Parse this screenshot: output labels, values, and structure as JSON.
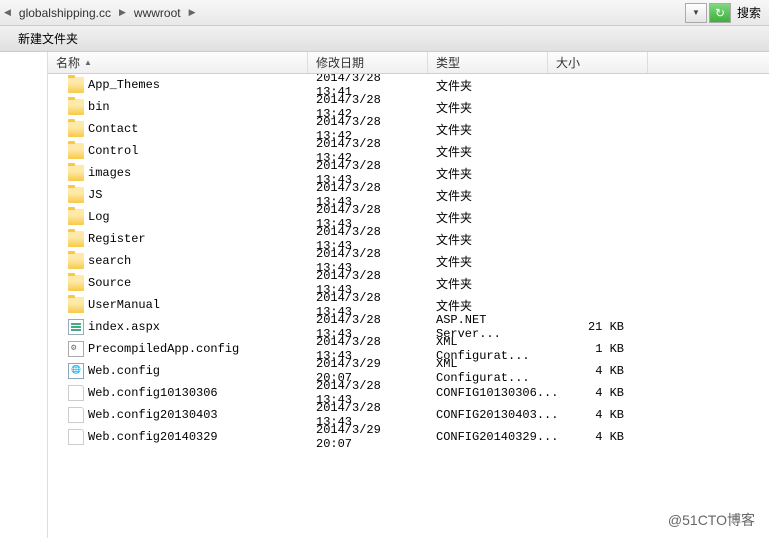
{
  "breadcrumb": {
    "items": [
      "globalshipping.cc",
      "wwwroot"
    ]
  },
  "toolbar": {
    "search_label": "搜索"
  },
  "subtoolbar": {
    "new_folder": "新建文件夹"
  },
  "columns": {
    "name": "名称",
    "date": "修改日期",
    "type": "类型",
    "size": "大小"
  },
  "files": [
    {
      "icon": "folder",
      "name": "App_Themes",
      "date": "2014/3/28 13:41",
      "type": "文件夹",
      "size": ""
    },
    {
      "icon": "folder",
      "name": "bin",
      "date": "2014/3/28 13:42",
      "type": "文件夹",
      "size": ""
    },
    {
      "icon": "folder",
      "name": "Contact",
      "date": "2014/3/28 13:42",
      "type": "文件夹",
      "size": ""
    },
    {
      "icon": "folder",
      "name": "Control",
      "date": "2014/3/28 13:42",
      "type": "文件夹",
      "size": ""
    },
    {
      "icon": "folder",
      "name": "images",
      "date": "2014/3/28 13:43",
      "type": "文件夹",
      "size": ""
    },
    {
      "icon": "folder",
      "name": "JS",
      "date": "2014/3/28 13:43",
      "type": "文件夹",
      "size": ""
    },
    {
      "icon": "folder",
      "name": "Log",
      "date": "2014/3/28 13:43",
      "type": "文件夹",
      "size": ""
    },
    {
      "icon": "folder",
      "name": "Register",
      "date": "2014/3/28 13:43",
      "type": "文件夹",
      "size": ""
    },
    {
      "icon": "folder",
      "name": "search",
      "date": "2014/3/28 13:43",
      "type": "文件夹",
      "size": ""
    },
    {
      "icon": "folder",
      "name": "Source",
      "date": "2014/3/28 13:43",
      "type": "文件夹",
      "size": ""
    },
    {
      "icon": "folder",
      "name": "UserManual",
      "date": "2014/3/28 13:43",
      "type": "文件夹",
      "size": ""
    },
    {
      "icon": "aspx",
      "name": "index.aspx",
      "date": "2014/3/28 13:43",
      "type": "ASP.NET Server...",
      "size": "21 KB"
    },
    {
      "icon": "config",
      "name": "PrecompiledApp.config",
      "date": "2014/3/28 13:43",
      "type": "XML Configurat...",
      "size": "1 KB"
    },
    {
      "icon": "webconfig",
      "name": "Web.config",
      "date": "2014/3/29 20:07",
      "type": "XML Configurat...",
      "size": "4 KB"
    },
    {
      "icon": "file",
      "name": "Web.config10130306",
      "date": "2014/3/28 13:43",
      "type": "CONFIG10130306...",
      "size": "4 KB"
    },
    {
      "icon": "file",
      "name": "Web.config20130403",
      "date": "2014/3/28 13:43",
      "type": "CONFIG20130403...",
      "size": "4 KB"
    },
    {
      "icon": "file",
      "name": "Web.config20140329",
      "date": "2014/3/29 20:07",
      "type": "CONFIG20140329...",
      "size": "4 KB"
    }
  ],
  "watermark": "@51CTO博客"
}
